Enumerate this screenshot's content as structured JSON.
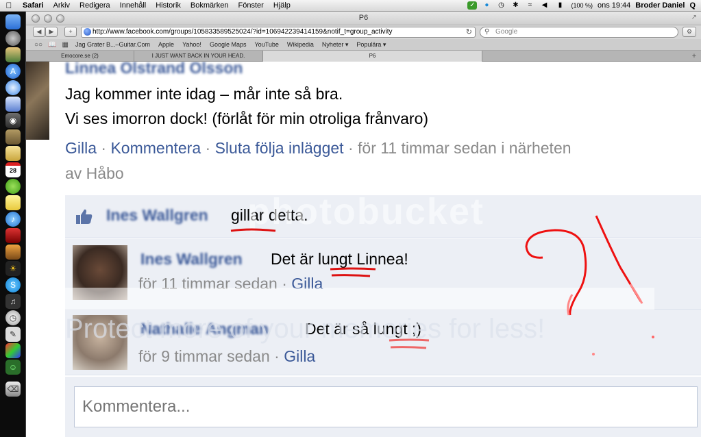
{
  "menubar": {
    "apple": "",
    "app": "Safari",
    "items": [
      "Arkiv",
      "Redigera",
      "Innehåll",
      "Historik",
      "Bokmärken",
      "Fönster",
      "Hjälp"
    ],
    "battery": "(100 %)",
    "clock": "ons 19:44",
    "user": "Broder Daniel",
    "search_glyph": "Q"
  },
  "dock": {
    "icons": [
      "finder-icon",
      "rocket-icon",
      "photo-icon",
      "app-store-icon",
      "safari-icon",
      "preview-icon",
      "facetime-icon",
      "gimp-icon",
      "notes-icon",
      "calendar-icon",
      "spotify-icon",
      "stickies-icon",
      "itunes-icon",
      "photobooth-icon",
      "iphoto-icon",
      "sun-icon",
      "skype-icon",
      "guitar-icon",
      "clock-icon",
      "pencil-icon",
      "chart-icon",
      "messenger-icon",
      "trash-icon"
    ],
    "calendar_day": "28"
  },
  "browser": {
    "window_title": "P6",
    "url": "http://www.facebook.com/groups/105833589525024/?id=106942239414159&notif_t=group_activity",
    "search_placeholder": "Google",
    "bookmarks": [
      "Jag Grater B...–Guitar.Com",
      "Apple",
      "Yahoo!",
      "Google Maps",
      "YouTube",
      "Wikipedia",
      "Nyheter ▾",
      "Populära ▾"
    ],
    "tabs": [
      {
        "label": "Emocore.se (2)",
        "active": false
      },
      {
        "label": "I JUST WANT BACK IN YOUR HEAD.",
        "active": false
      },
      {
        "label": "P6",
        "active": true
      }
    ]
  },
  "post": {
    "author": "Linnea Olstrand Olsson",
    "line1": "Jag kommer inte idag – mår inte så bra.",
    "line2": "Vi ses imorron dock! (förlåt för min otroliga frånvaro)",
    "action_like": "Gilla",
    "action_comment": "Kommentera",
    "action_unfollow": "Sluta följa inlägget",
    "sep": "·",
    "time": "för 11 timmar sedan i närheten",
    "location": "av Håbo"
  },
  "likes": {
    "names": "Ines Wallgren",
    "text": "gillar detta."
  },
  "comments": [
    {
      "name": "Ines Wallgren",
      "text": "Det är lungt Linnea!",
      "time": "för 11 timmar sedan",
      "like": "Gilla"
    },
    {
      "name": "Nathalie Angman",
      "text": "Det är så lungt ;)",
      "time": "för 9 timmar sedan",
      "like": "Gilla"
    }
  ],
  "comment_input": {
    "placeholder": "Kommentera..."
  },
  "watermark": {
    "text": "photobucket",
    "text2": "Protect more of your memories for less!"
  },
  "colors": {
    "link": "#3b5998",
    "muted": "#8a8a8a",
    "panel": "#eceff5",
    "scribble": "#e02020"
  }
}
